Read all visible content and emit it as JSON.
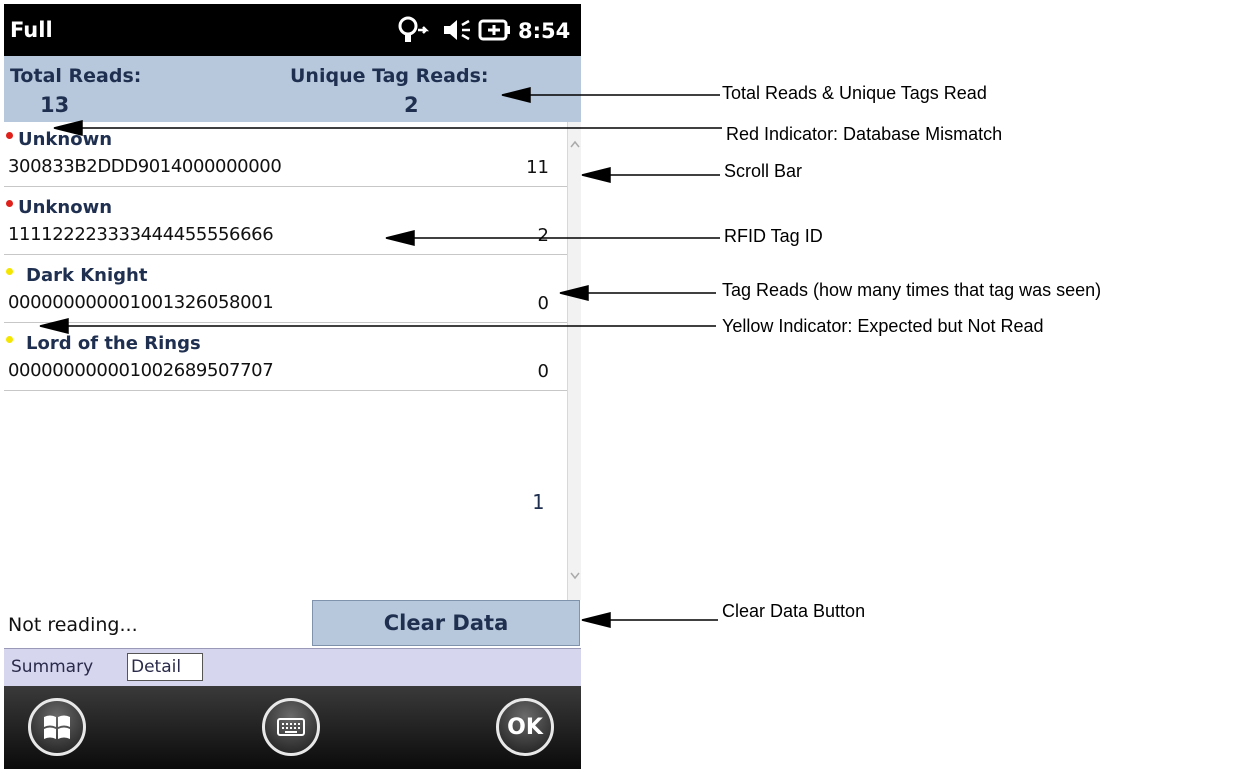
{
  "status_bar": {
    "title": "Full",
    "time": "8:54"
  },
  "header": {
    "total_reads_label": "Total Reads:",
    "total_reads_value": "13",
    "unique_label": "Unique Tag Reads:",
    "unique_value": "2"
  },
  "rows": [
    {
      "name": "Unknown",
      "tag_id": "300833B2DDD9014000000000",
      "count": "11",
      "indicator": "red"
    },
    {
      "name": "Unknown",
      "tag_id": "111122223333444455556666",
      "count": "2",
      "indicator": "red"
    },
    {
      "name": "Dark Knight",
      "tag_id": "000000000001001326058001",
      "count": "0",
      "indicator": "yellow"
    },
    {
      "name": "Lord of the Rings",
      "tag_id": "000000000001002689507707",
      "count": "0",
      "indicator": "yellow"
    }
  ],
  "stray_value": "1",
  "footer": {
    "status": "Not reading...",
    "clear_label": "Clear Data"
  },
  "tabs": [
    {
      "label": "Summary"
    },
    {
      "label": "Detail"
    }
  ],
  "taskbar": {
    "ok_label": "OK",
    "icons": [
      "windows-start-icon",
      "keyboard-icon"
    ]
  },
  "colors": {
    "header_bg": "#b7c8dc",
    "red_indicator": "#e0201a",
    "yellow_indicator": "#f5e600",
    "text_navy": "#1f2f4f"
  },
  "annotations": {
    "total_unique": "Total Reads & Unique Tags Read",
    "red_indicator": "Red Indicator: Database Mismatch",
    "scroll_bar": "Scroll Bar",
    "rfid_tag_id": "RFID Tag ID",
    "tag_reads": "Tag Reads (how many times that tag was seen)",
    "yellow_indicator": "Yellow Indicator: Expected but Not Read",
    "clear_data_button": "Clear Data Button"
  }
}
